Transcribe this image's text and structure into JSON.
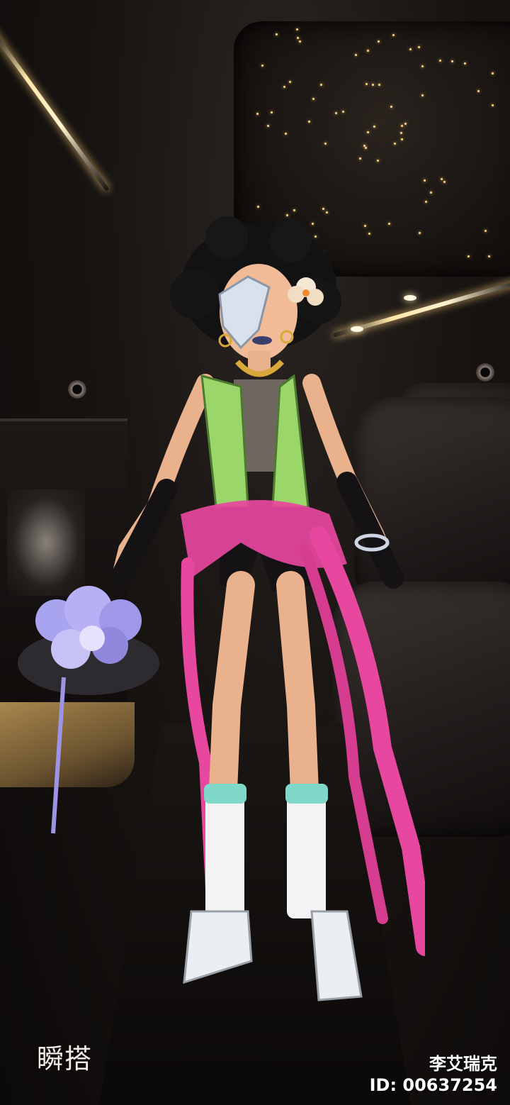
{
  "watermark": {
    "logo_text": "瞬搭"
  },
  "player": {
    "name": "李艾瑞克",
    "id_label": "ID:",
    "id_value": "00637254"
  },
  "scene": {
    "setting": "limousine-interior",
    "colors": {
      "ceiling_stars": "#ffd98a",
      "light_strip": "#ffe6a8",
      "gold_trim": "#a8864d",
      "vest": "#9bd66a",
      "skirt": "#e8479f",
      "socks_cuff": "#7fd8c8",
      "bouquet": "#a9a4f0"
    }
  }
}
